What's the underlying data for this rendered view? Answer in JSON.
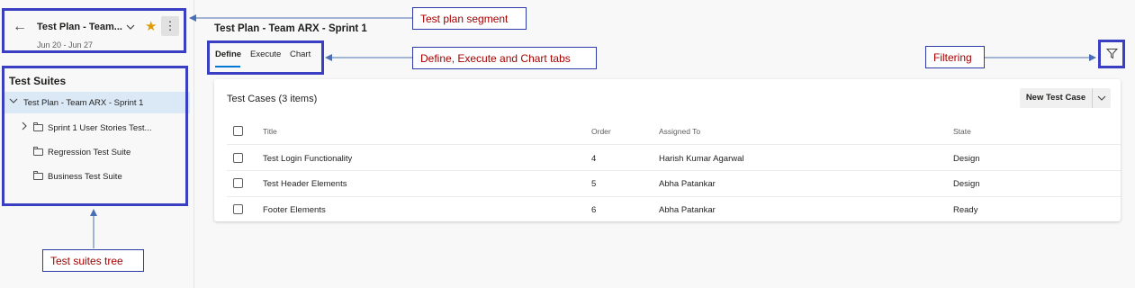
{
  "plan": {
    "name": "Test Plan - Team...",
    "dates": "Jun 20 - Jun 27",
    "more_label": "⋮"
  },
  "sidebar": {
    "title": "Test Suites",
    "items": [
      {
        "label": "Test Plan - Team ARX - Sprint 1"
      },
      {
        "label": "Sprint 1 User Stories Test..."
      },
      {
        "label": "Regression Test Suite"
      },
      {
        "label": "Business Test Suite"
      }
    ]
  },
  "header": {
    "title": "Test Plan - Team ARX - Sprint 1",
    "tabs": [
      {
        "label": "Define"
      },
      {
        "label": "Execute"
      },
      {
        "label": "Chart"
      }
    ]
  },
  "card": {
    "title": "Test Cases (3 items)",
    "new_button": "New Test Case",
    "columns": [
      "Title",
      "Order",
      "Assigned To",
      "State"
    ],
    "rows": [
      {
        "title": "Test Login Functionality",
        "order": "4",
        "assigned": "Harish Kumar Agarwal",
        "state": "Design"
      },
      {
        "title": "Test Header Elements",
        "order": "5",
        "assigned": "Abha Patankar",
        "state": "Design"
      },
      {
        "title": "Footer Elements",
        "order": "6",
        "assigned": "Abha Patankar",
        "state": "Ready"
      }
    ]
  },
  "annotations": {
    "plan_segment": "Test plan segment",
    "tabs": "Define, Execute and Chart tabs",
    "filtering": "Filtering",
    "suites_tree": "Test suites tree"
  },
  "colors": {
    "accent": "#0078d4",
    "annotation_border": "#3a3fc1",
    "annotation_text": "#a50000",
    "star": "#e09b00"
  }
}
